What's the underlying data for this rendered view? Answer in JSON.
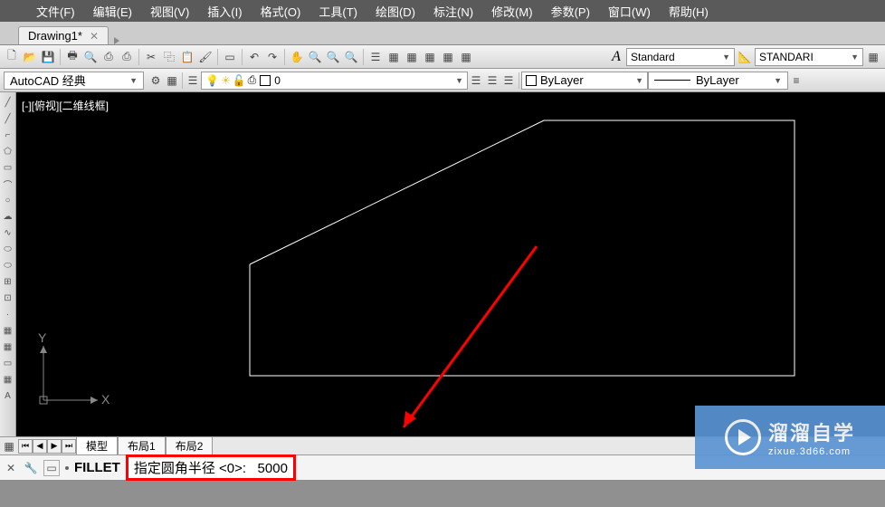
{
  "menubar": {
    "file": "文件(F)",
    "edit": "编辑(E)",
    "view": "视图(V)",
    "insert": "插入(I)",
    "format": "格式(O)",
    "tools": "工具(T)",
    "draw": "绘图(D)",
    "dimension": "标注(N)",
    "modify": "修改(M)",
    "parametric": "参数(P)",
    "window": "窗口(W)",
    "help": "帮助(H)"
  },
  "tabs": {
    "drawing1": "Drawing1*"
  },
  "toolbar1": {
    "textstyle_label": "Standard",
    "dimstyle_label": "STANDARI"
  },
  "workspace": {
    "selected": "AutoCAD 经典"
  },
  "layer": {
    "current": "0",
    "bylayer": "ByLayer",
    "linetype": "ByLayer"
  },
  "viewport": {
    "label": "[-][俯视][二维线框]"
  },
  "layout_tabs": {
    "model": "模型",
    "layout1": "布局1",
    "layout2": "布局2"
  },
  "command": {
    "prefix": "FILLET",
    "prompt": "指定圆角半径 <0>:",
    "value": "5000"
  },
  "watermark": {
    "title": "溜溜自学",
    "url": "zixue.3d66.com"
  },
  "ucs": {
    "x": "X",
    "y": "Y"
  }
}
